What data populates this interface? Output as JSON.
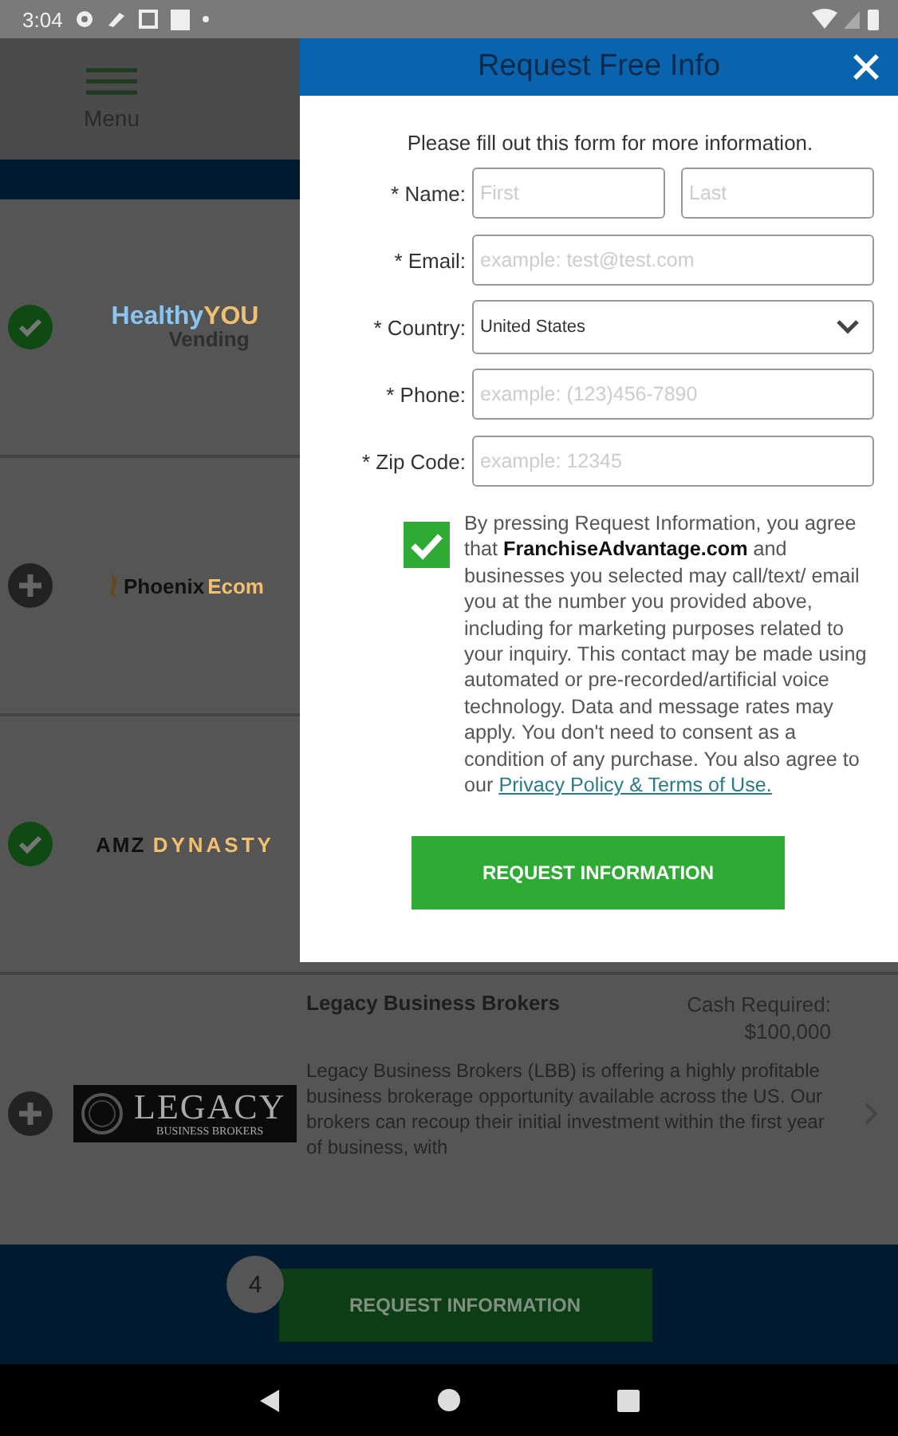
{
  "status_bar": {
    "time": "3:04"
  },
  "header": {
    "menu_label": "Menu"
  },
  "listings": [
    {
      "logo": [
        "Healthy",
        "YOU",
        "Vending"
      ],
      "kind": "healthy",
      "selected": true
    },
    {
      "logo": [
        "Phoenix",
        "Ecom"
      ],
      "kind": "phoenix",
      "selected": false
    },
    {
      "logo": [
        "AMZ",
        "DYNASTY"
      ],
      "kind": "amz",
      "selected": true
    },
    {
      "logo": [
        "LEGACY",
        "BUSINESS BROKERS"
      ],
      "kind": "legacy",
      "selected": false,
      "title": "Legacy Business Brokers",
      "cash_label": "Cash Required:",
      "cash": "$100,000",
      "description": "Legacy Business Brokers (LBB) is offering a highly profitable business brokerage opportunity available across the US. Our brokers can recoup their initial investment within the first year of business, with"
    }
  ],
  "footer": {
    "count": "4",
    "button": "REQUEST INFORMATION"
  },
  "modal": {
    "title": "Request Free Info",
    "intro": "Please fill out this form for more information.",
    "fields": [
      {
        "label": "* Name:",
        "kind": "pair",
        "placeholders": [
          "First",
          "Last"
        ]
      },
      {
        "label": "* Email:",
        "kind": "text",
        "placeholder": "example: test@test.com"
      },
      {
        "label": "* Country:",
        "kind": "select",
        "value": "United States"
      },
      {
        "label": "* Phone:",
        "kind": "text",
        "placeholder": "example: (123)456-7890"
      },
      {
        "label": "* Zip Code:",
        "kind": "text",
        "placeholder": "example: 12345"
      }
    ],
    "consent": {
      "checked": true,
      "text": "By pressing Request Information, you agree that **FranchiseAdvantage.com** and businesses you selected may call/text/ email you at the number you provided above, including for marketing purposes related to your inquiry. This contact may be made using automated or pre-recorded/artificial voice technology. Data and message rates may apply. You don't need to consent as a condition of any purchase. You also agree to our",
      "link": "Privacy Policy & Terms of Use."
    },
    "button": "REQUEST INFORMATION"
  }
}
